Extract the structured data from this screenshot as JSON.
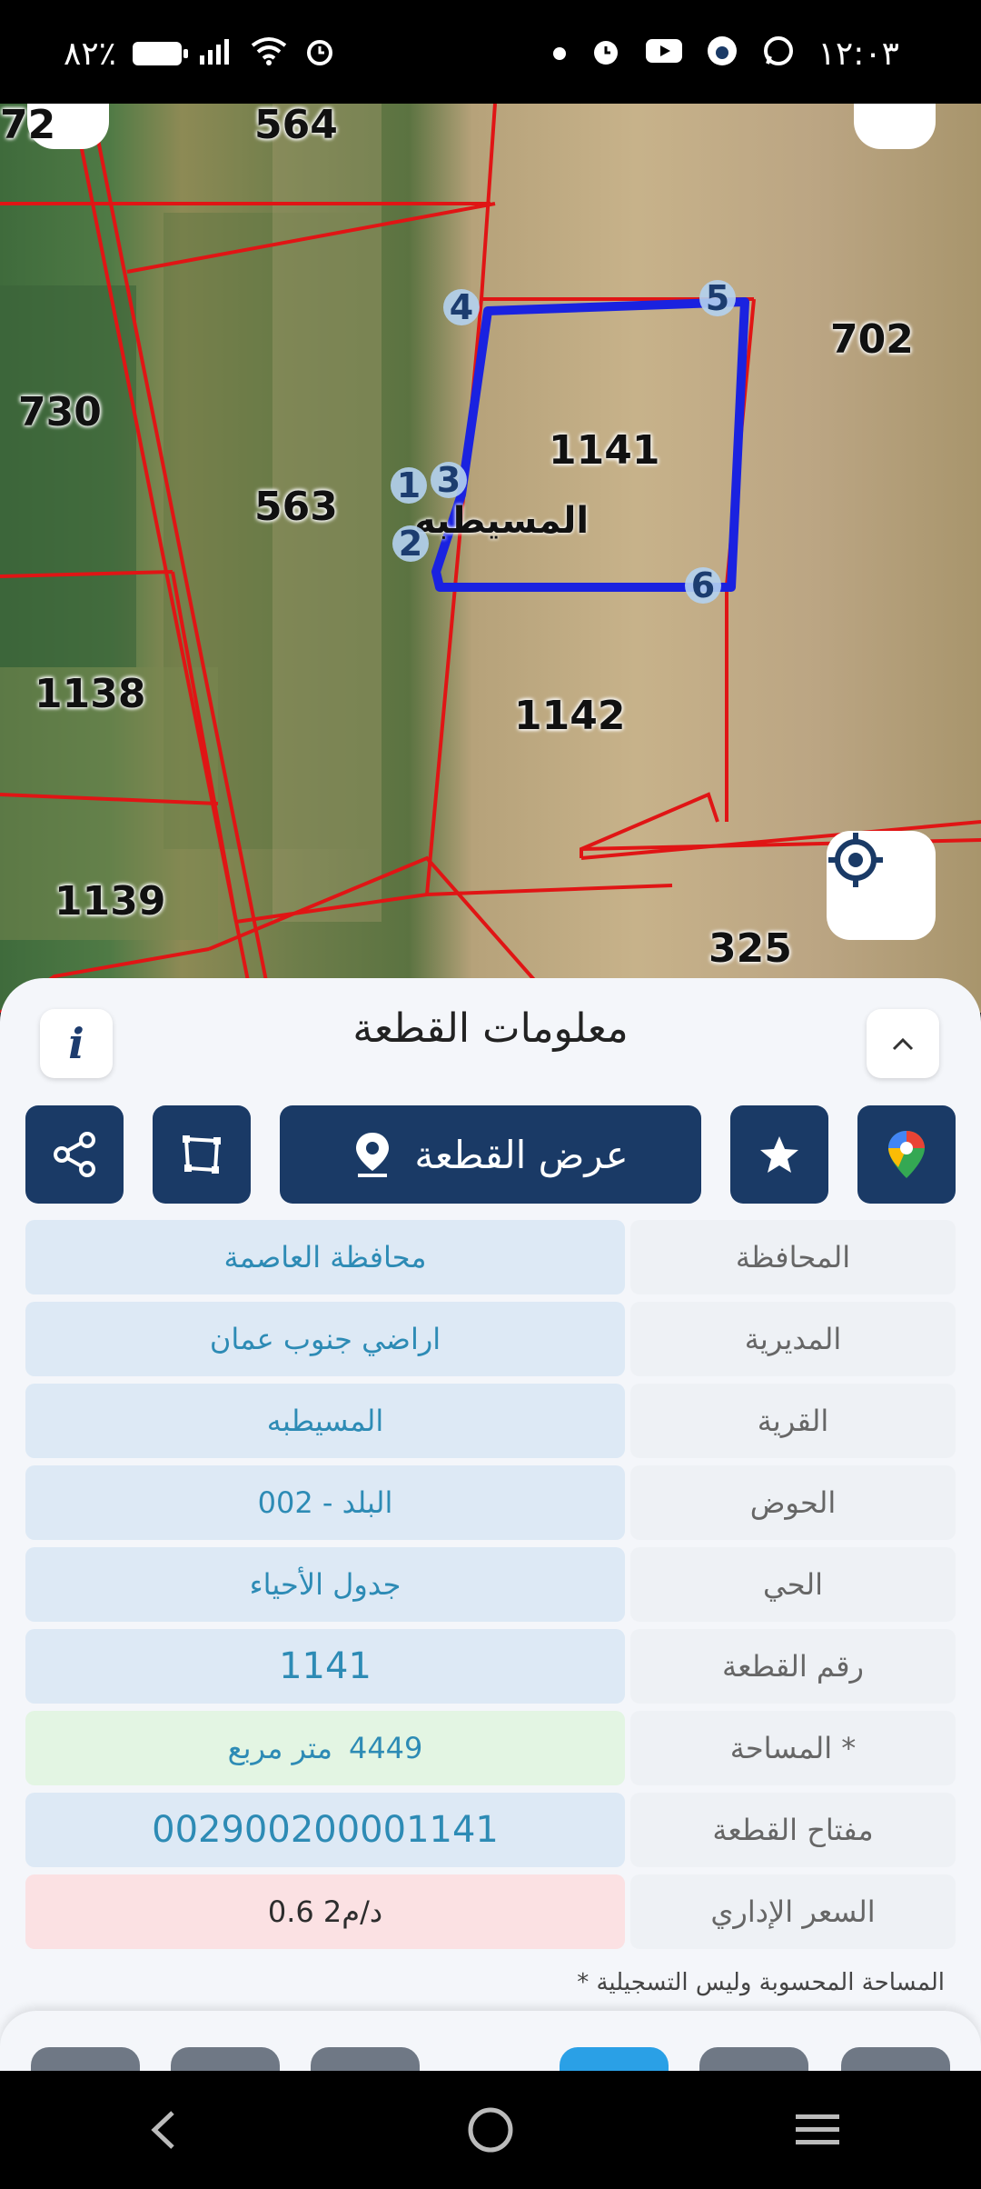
{
  "status_bar": {
    "battery": "٨٢٪",
    "time": "١٢:٠٣",
    "left_icons": [
      "battery-icon",
      "signal-icon",
      "wifi-icon",
      "alarm-icon"
    ],
    "right_icons": [
      "dot-icon",
      "alarm-icon",
      "youtube-icon",
      "app-icon",
      "whatsapp-icon"
    ]
  },
  "map": {
    "parcel_labels": {
      "p564": "564",
      "p72": "72",
      "p702": "702",
      "p730": "730",
      "p1141": "1141",
      "p563": "563",
      "p1138": "1138",
      "p1142": "1142",
      "p1139": "1139",
      "p325": "325"
    },
    "village_label": "المسيطبه",
    "vertices": [
      "1",
      "2",
      "3",
      "4",
      "5",
      "6"
    ]
  },
  "panel": {
    "title": "معلومات القطعة",
    "actions": {
      "view_parcel": "عرض القطعة"
    },
    "rows": [
      {
        "label": "المحافظة",
        "value": "محافظة العاصمة"
      },
      {
        "label": "المديرية",
        "value": "اراضي جنوب عمان"
      },
      {
        "label": "القرية",
        "value": "المسيطبه"
      },
      {
        "label": "الحوض",
        "value": "البلد - 002"
      },
      {
        "label": "الحي",
        "value": "جدول الأحياء"
      },
      {
        "label": "رقم القطعة",
        "value": "1141"
      },
      {
        "label": "المساحة *",
        "value_number": "4449",
        "value_unit": "متر مربع"
      },
      {
        "label": "مفتاح القطعة",
        "value": "002900200001141"
      },
      {
        "label": "السعر الإداري",
        "value": "0.6 د/م2"
      }
    ],
    "footnote": "* المساحة المحسوبة وليس التسجيلية"
  },
  "colors": {
    "primary": "#1a3a66",
    "parcel_outline": "#1a22e0",
    "boundary": "#e01515",
    "value_text": "#2d8bb5"
  }
}
